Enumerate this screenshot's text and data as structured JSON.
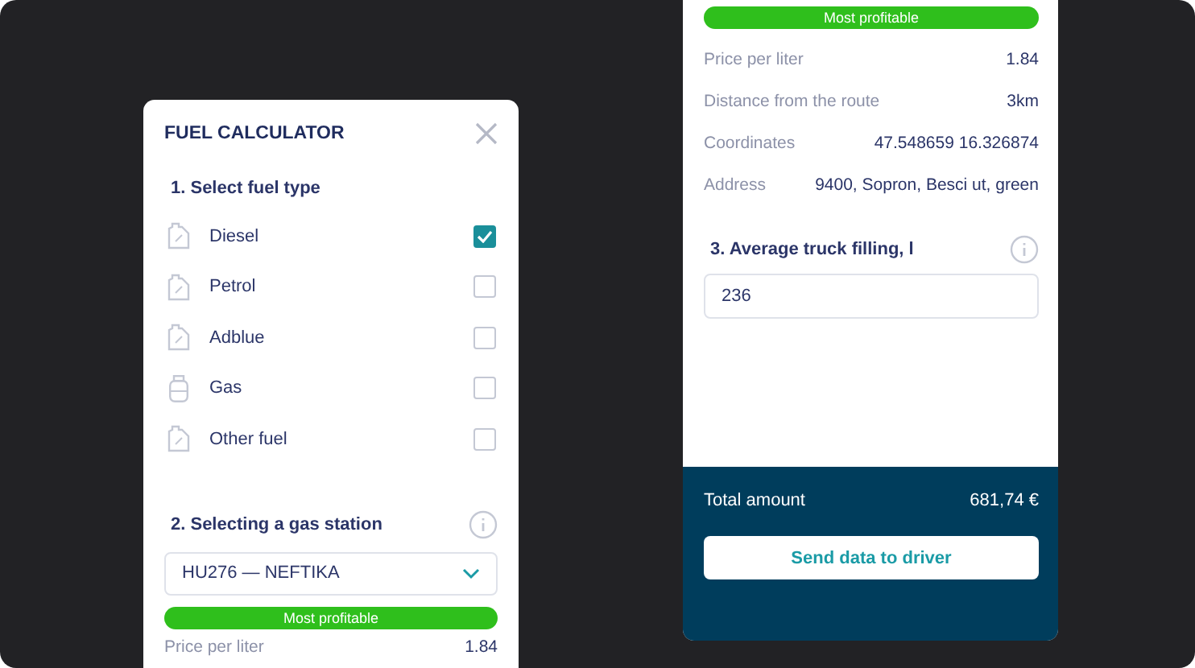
{
  "left_panel": {
    "title": "FUEL CALCULATOR",
    "section_1": "1. Select fuel type",
    "fuel_types": [
      {
        "label": "Diesel",
        "kind": "canister",
        "checked": true
      },
      {
        "label": "Petrol",
        "kind": "canister",
        "checked": false
      },
      {
        "label": "Adblue",
        "kind": "canister",
        "checked": false
      },
      {
        "label": "Gas",
        "kind": "cylinder",
        "checked": false
      },
      {
        "label": "Other fuel",
        "kind": "canister",
        "checked": false
      }
    ],
    "section_2": "2. Selecting a gas station",
    "station_select": {
      "value": "HU276 — NEFTIKA"
    },
    "badge": "Most profitable",
    "details": [
      {
        "label": "Price per liter",
        "value": "1.84"
      }
    ]
  },
  "right_panel": {
    "badge": "Most profitable",
    "details": [
      {
        "label": "Price per liter",
        "value": "1.84"
      },
      {
        "label": "Distance from the route",
        "value": "3km"
      },
      {
        "label": "Coordinates",
        "value": "47.548659 16.326874"
      },
      {
        "label": "Address",
        "value": "9400, Sopron, Besci ut, green"
      }
    ],
    "section_3": "3. Average truck filling, l",
    "filling_input": {
      "value": "236"
    },
    "total": {
      "label": "Total amount",
      "value": "681,74 €"
    },
    "send_button": "Send data to driver"
  }
}
